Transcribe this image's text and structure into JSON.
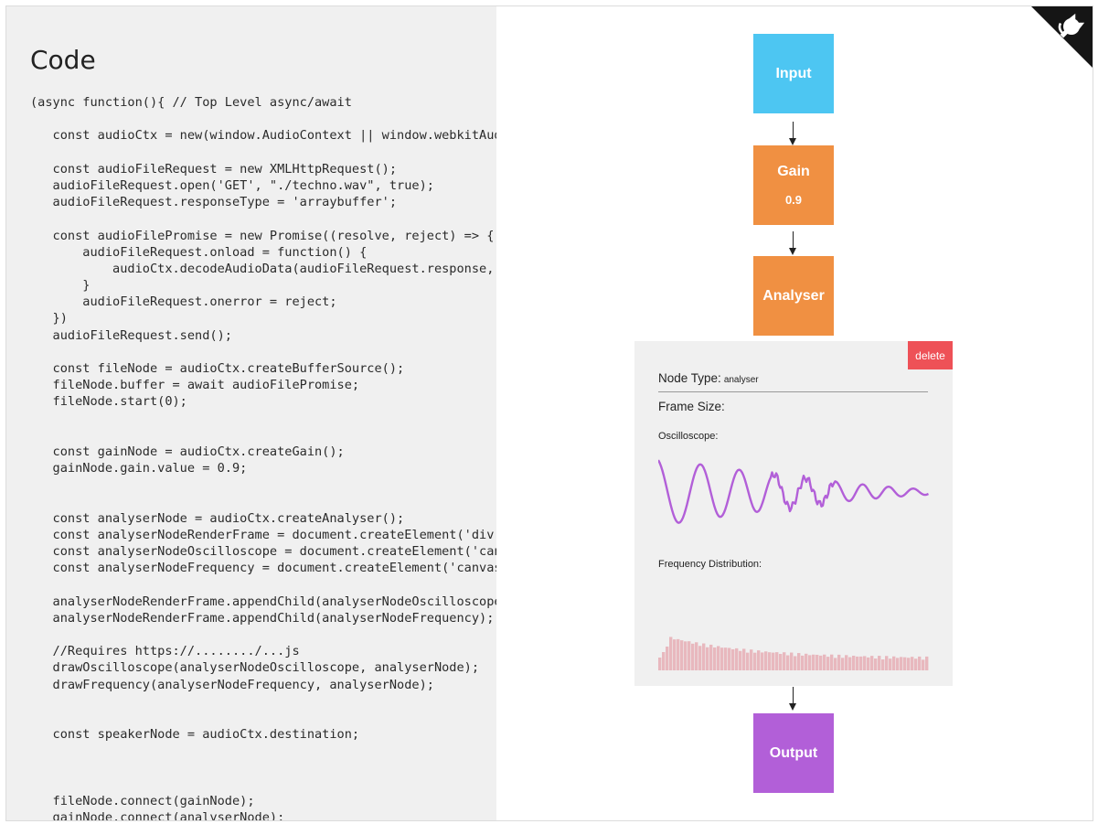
{
  "code_panel": {
    "title": "Code",
    "lines": [
      "(async function(){ // Top Level async/await",
      "",
      "   const audioCtx = new(window.AudioContext || window.webkitAudioContext)();",
      "",
      "   const audioFileRequest = new XMLHttpRequest();",
      "   audioFileRequest.open('GET', \"./techno.wav\", true);",
      "   audioFileRequest.responseType = 'arraybuffer';",
      "",
      "   const audioFilePromise = new Promise((resolve, reject) => {",
      "       audioFileRequest.onload = function() {",
      "           audioCtx.decodeAudioData(audioFileRequest.response, resolve, reject);",
      "       }",
      "       audioFileRequest.onerror = reject;",
      "   })",
      "   audioFileRequest.send();",
      "",
      "   const fileNode = audioCtx.createBufferSource();",
      "   fileNode.buffer = await audioFilePromise;",
      "   fileNode.start(0);",
      "",
      "",
      "   const gainNode = audioCtx.createGain();",
      "   gainNode.gain.value = 0.9;",
      "",
      "",
      "   const analyserNode = audioCtx.createAnalyser();",
      "   const analyserNodeRenderFrame = document.createElement('div');",
      "   const analyserNodeOscilloscope = document.createElement('canvas');",
      "   const analyserNodeFrequency = document.createElement('canvas');",
      "",
      "   analyserNodeRenderFrame.appendChild(analyserNodeOscilloscope);",
      "   analyserNodeRenderFrame.appendChild(analyserNodeFrequency);",
      "",
      "   //Requires https://......../...js",
      "   drawOscilloscope(analyserNodeOscilloscope, analyserNode);",
      "   drawFrequency(analyserNodeFrequency, analyserNode);",
      "",
      "",
      "   const speakerNode = audioCtx.destination;",
      "",
      "",
      "",
      "   fileNode.connect(gainNode);",
      "   gainNode.connect(analyserNode);"
    ]
  },
  "graph": {
    "nodes": {
      "input": {
        "label": "Input",
        "color": "#4dc6f2"
      },
      "gain": {
        "label": "Gain",
        "value": "0.9",
        "color": "#f09042"
      },
      "analyser": {
        "label": "Analyser",
        "color": "#f09042"
      },
      "output": {
        "label": "Output",
        "color": "#b25fd8"
      }
    },
    "detail": {
      "delete_label": "delete",
      "node_type_label": "Node Type:",
      "node_type_value": "analyser",
      "frame_size_label": "Frame Size:",
      "oscilloscope_label": "Oscilloscope:",
      "frequency_label": "Frequency Distribution:",
      "oscilloscope_color": "#b25fd8",
      "frequency_color": "#e8b8be"
    }
  },
  "corner_icon": "github-octocat-icon"
}
